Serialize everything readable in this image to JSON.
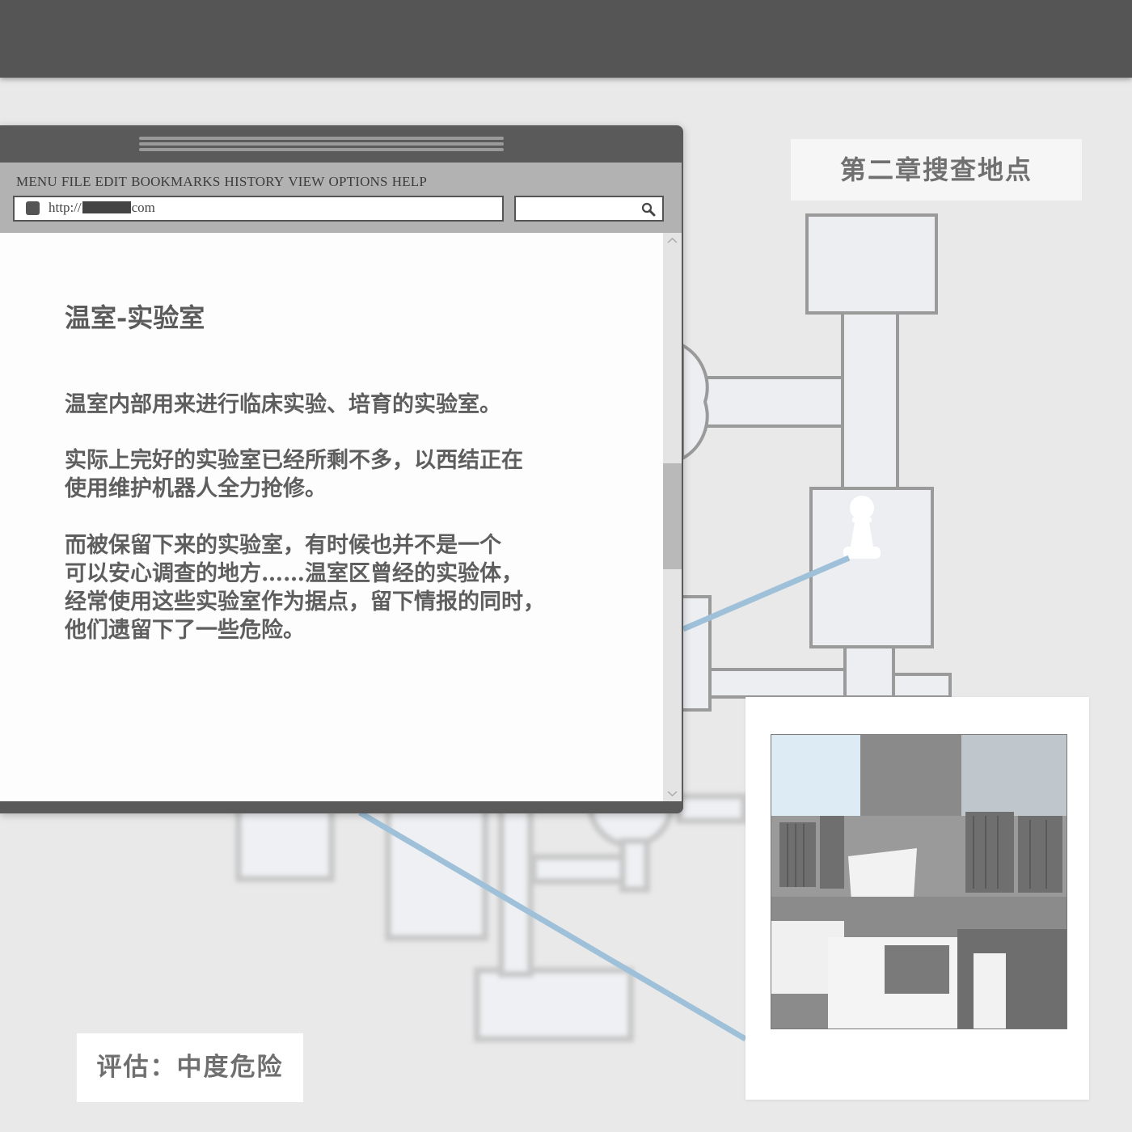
{
  "chapter_card": {
    "title": "第二章搜查地点"
  },
  "browser": {
    "menu": [
      "MENU",
      "FILE",
      "EDIT",
      "BOOKMARKS",
      "HISTORY",
      "VIEW",
      "OPTIONS",
      "HELP"
    ],
    "url": {
      "prefix": "http://",
      "suffix": "com"
    },
    "search": {
      "value": ""
    }
  },
  "page": {
    "title": "温室-实验室",
    "paragraphs": [
      [
        "温室内部用来进行临床实验、培育的实验室。"
      ],
      [
        "实际上完好的实验室已经所剩不多，以西结正在",
        "使用维护机器人全力抢修。"
      ],
      [
        "而被保留下来的实验室，有时候也并不是一个",
        "可以安心调查的地方……温室区曾经的实验体，",
        "经常使用这些实验室作为据点，留下情报的同时，",
        "他们遗留下了一些危险。"
      ]
    ]
  },
  "assessment": {
    "label": "评估：中度危险"
  },
  "colors": {
    "connector": "#9fc0d9",
    "topbar": "#555556",
    "window": "#5a5a5a"
  }
}
